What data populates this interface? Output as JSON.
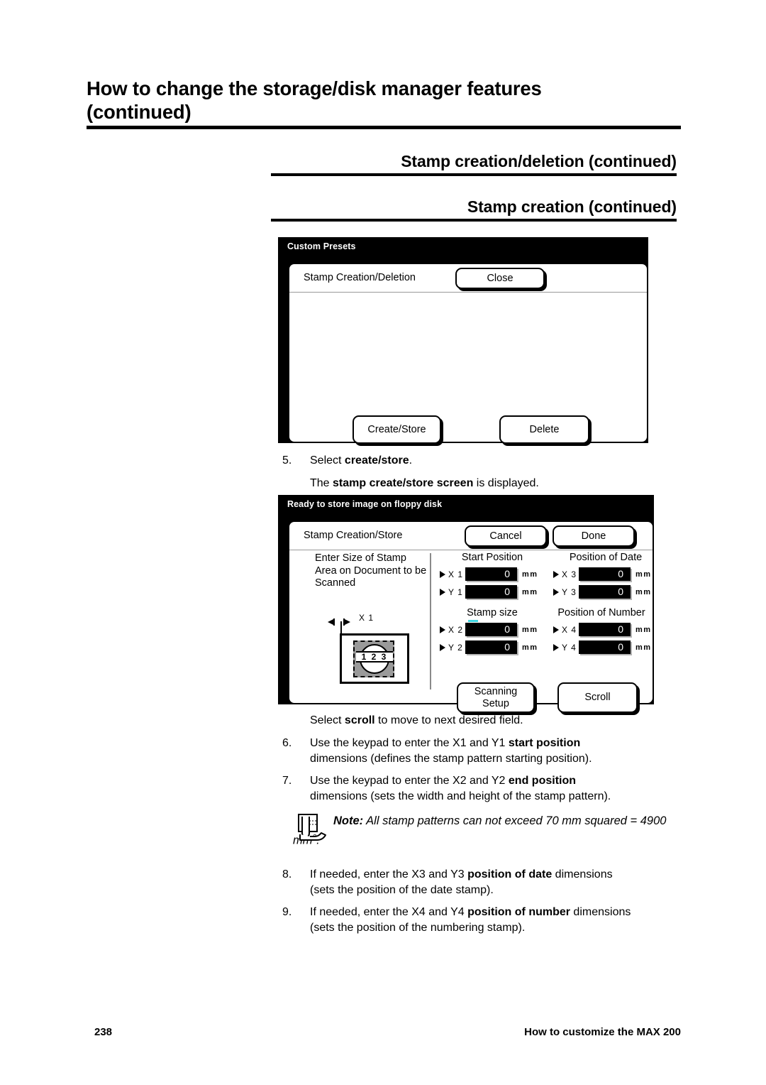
{
  "heading": {
    "line1": "How to change the storage/disk manager features",
    "line2": "(continued)"
  },
  "subheadings": {
    "first": "Stamp creation/deletion (continued)",
    "second": "Stamp creation (continued)"
  },
  "panel_custom_presets": {
    "title_bar": "Custom Presets",
    "screen_name": "Stamp Creation/Deletion",
    "close_label": "Close",
    "create_store_label": "Create/Store",
    "delete_label": "Delete"
  },
  "step5": {
    "number": "5.",
    "line1_pre": "Select ",
    "line1_bold": "create/store",
    "line1_post": ".",
    "line2_pre": "The ",
    "line2_bold": "stamp create/store screen",
    "line2_post": " is displayed."
  },
  "panel_stamp_store": {
    "title_bar": "Ready to store image on floppy disk",
    "screen_name": "Stamp Creation/Store",
    "cancel_label": "Cancel",
    "done_label": "Done",
    "help_text": "Enter Size of Stamp Area on Document to be Scanned",
    "figure": {
      "dimension_label": "X 1",
      "stamp_digits": "1 2 3"
    },
    "groups": [
      {
        "title": "Start Position",
        "rows": [
          {
            "label": "X 1",
            "value": "0",
            "unit": "mm"
          },
          {
            "label": "Y 1",
            "value": "0",
            "unit": "mm"
          }
        ]
      },
      {
        "title": "Position of Date",
        "rows": [
          {
            "label": "X 3",
            "value": "0",
            "unit": "mm"
          },
          {
            "label": "Y 3",
            "value": "0",
            "unit": "mm"
          }
        ]
      },
      {
        "title": "Stamp size",
        "rows": [
          {
            "label": "X 2",
            "value": "0",
            "unit": "mm"
          },
          {
            "label": "Y 2",
            "value": "0",
            "unit": "mm"
          }
        ]
      },
      {
        "title": "Position of Number",
        "rows": [
          {
            "label": "X 4",
            "value": "0",
            "unit": "mm"
          },
          {
            "label": "Y 4",
            "value": "0",
            "unit": "mm"
          }
        ]
      }
    ],
    "scanning_setup_label_line1": "Scanning",
    "scanning_setup_label_line2": "Setup",
    "scroll_label": "Scroll"
  },
  "scroll_note": {
    "pre": "Select ",
    "bold": "scroll",
    "post": " to move to next desired field."
  },
  "step6": {
    "number": "6.",
    "line1_pre": "Use the keypad to enter the X1 and Y1 ",
    "line1_bold": "start position",
    "line2": "dimensions (defines the stamp pattern starting position)."
  },
  "step7": {
    "number": "7.",
    "line1_pre": "Use the keypad to enter the X2 and Y2 ",
    "line1_bold": "end position",
    "line2": "dimensions (sets the width and height of the stamp pattern)."
  },
  "note": {
    "label": "Note:",
    "text": "All stamp patterns can not exceed 70 mm squared = 4900 mm",
    "superscript": "2",
    "tail": "."
  },
  "step8": {
    "number": "8.",
    "line1_pre": "If needed, enter the X3 and Y3 ",
    "line1_bold": "position of date",
    "line1_post": " dimensions",
    "line2": "(sets the position of the date stamp)."
  },
  "step9": {
    "number": "9.",
    "line1_pre": "If needed, enter the X4 and Y4 ",
    "line1_bold": "position of number",
    "line1_post": " dimensions",
    "line2": "(sets the position of the numbering stamp)."
  },
  "footer": {
    "page_number": "238",
    "title": "How to customize the MAX 200"
  },
  "colors": {
    "panel_background": "#000000",
    "panel_surface": "#ffffff",
    "field_background": "#000000",
    "field_text": "#ffffff",
    "highlight_mark": "#3fd6e0",
    "stamp_area_fill": "#9a9a9a"
  }
}
